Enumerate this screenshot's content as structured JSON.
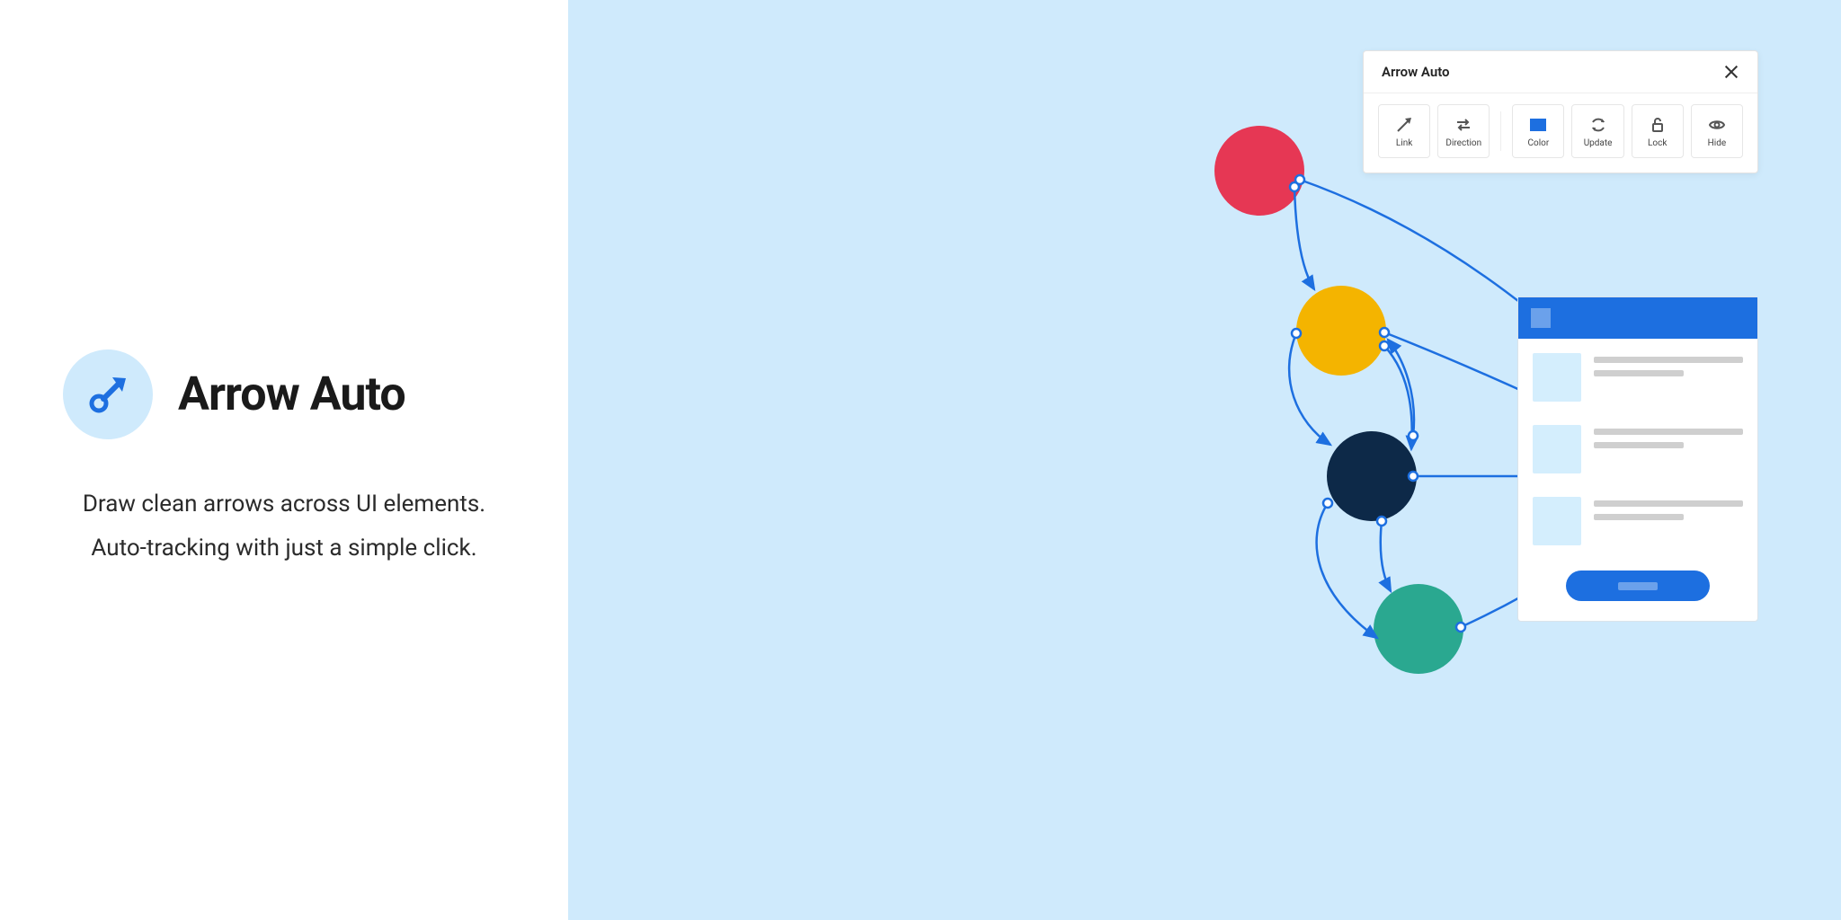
{
  "app": {
    "title": "Arrow Auto",
    "subtitle_line1": "Draw clean arrows across UI elements.",
    "subtitle_line2": "Auto-tracking with just a simple click."
  },
  "toolbar": {
    "title": "Arrow Auto",
    "buttons": [
      {
        "label": "Link",
        "icon": "arrow-icon"
      },
      {
        "label": "Direction",
        "icon": "swap-icon"
      },
      {
        "label": "Color",
        "icon": "color-icon"
      },
      {
        "label": "Update",
        "icon": "refresh-icon"
      },
      {
        "label": "Lock",
        "icon": "lock-icon"
      },
      {
        "label": "Hide",
        "icon": "eye-icon"
      }
    ]
  },
  "nodes": {
    "red": "#e63754",
    "yellow": "#f4b400",
    "navy": "#0d2948",
    "teal": "#2aa890"
  },
  "colors": {
    "accent": "#1d6fe0",
    "light_blue": "#cfeafc"
  }
}
